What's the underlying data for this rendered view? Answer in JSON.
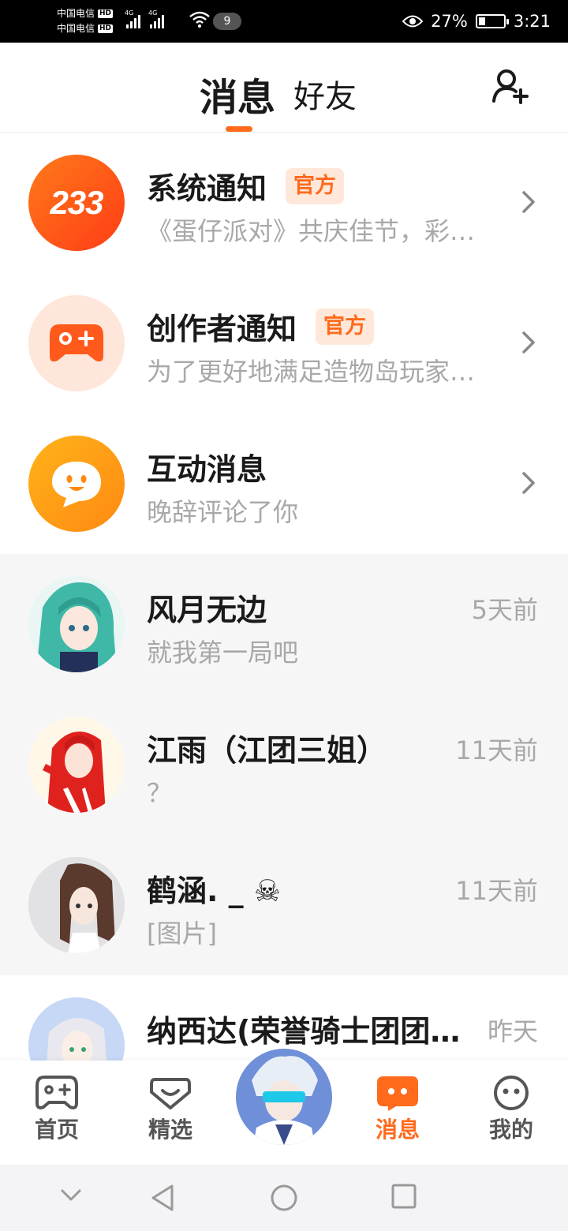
{
  "status_bar": {
    "carrier_1": "中国电信",
    "carrier_2": "中国电信",
    "hd": "HD",
    "network": "4G",
    "notification_count": "9",
    "battery_percent": "27%",
    "battery_level": 0.27,
    "time": "3:21"
  },
  "header": {
    "tab_messages": "消息",
    "tab_friends": "好友"
  },
  "official_rows": [
    {
      "title": "系统通知",
      "badge": "官方",
      "preview": "《蛋仔派对》共庆佳节，彩…",
      "avatar_text": "233"
    },
    {
      "title": "创作者通知",
      "badge": "官方",
      "preview": "为了更好地满足造物岛玩家…"
    },
    {
      "title": "互动消息",
      "preview": "晚辞评论了你"
    }
  ],
  "chats": [
    {
      "name": "风月无边",
      "preview": "就我第一局吧",
      "time": "5天前"
    },
    {
      "name": "江雨（江团三姐）",
      "preview": "？",
      "time": "11天前"
    },
    {
      "name": "鹤涵. _ ☠",
      "preview": "[图片]",
      "time": "11天前"
    },
    {
      "name": "纳西达(荣誉骑士团团…",
      "preview": "",
      "time": "昨天"
    }
  ],
  "bottom_nav": {
    "home": "首页",
    "featured": "精选",
    "messages": "消息",
    "mine": "我的"
  },
  "colors": {
    "accent": "#ff6a1c",
    "badge_bg": "#ffe8d9",
    "muted_text": "#a8a8a8"
  },
  "icons": [
    "add-friend-icon",
    "gamepad-icon",
    "heart-box-icon",
    "chat-bubble-icon",
    "smiley-face-icon",
    "chevron-right-icon"
  ]
}
